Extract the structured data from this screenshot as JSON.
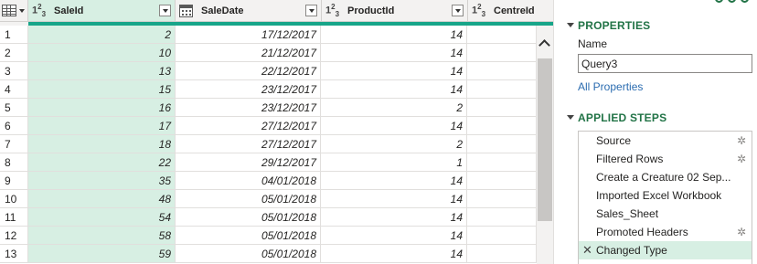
{
  "grid": {
    "columns": [
      {
        "name": "SaleId",
        "type": "1²3"
      },
      {
        "name": "SaleDate",
        "type": "date"
      },
      {
        "name": "ProductId",
        "type": "1²3"
      },
      {
        "name": "CentreId",
        "type": "1²3"
      }
    ],
    "rows": [
      {
        "n": "1",
        "sale_id": "2",
        "sale_date": "17/12/2017",
        "product_id": "14"
      },
      {
        "n": "2",
        "sale_id": "10",
        "sale_date": "21/12/2017",
        "product_id": "14"
      },
      {
        "n": "3",
        "sale_id": "13",
        "sale_date": "22/12/2017",
        "product_id": "14"
      },
      {
        "n": "4",
        "sale_id": "15",
        "sale_date": "23/12/2017",
        "product_id": "14"
      },
      {
        "n": "5",
        "sale_id": "16",
        "sale_date": "23/12/2017",
        "product_id": "2"
      },
      {
        "n": "6",
        "sale_id": "17",
        "sale_date": "27/12/2017",
        "product_id": "14"
      },
      {
        "n": "7",
        "sale_id": "18",
        "sale_date": "27/12/2017",
        "product_id": "2"
      },
      {
        "n": "8",
        "sale_id": "22",
        "sale_date": "29/12/2017",
        "product_id": "1"
      },
      {
        "n": "9",
        "sale_id": "35",
        "sale_date": "04/01/2018",
        "product_id": "14"
      },
      {
        "n": "10",
        "sale_id": "48",
        "sale_date": "05/01/2018",
        "product_id": "14"
      },
      {
        "n": "11",
        "sale_id": "54",
        "sale_date": "05/01/2018",
        "product_id": "14"
      },
      {
        "n": "12",
        "sale_id": "58",
        "sale_date": "05/01/2018",
        "product_id": "14"
      },
      {
        "n": "13",
        "sale_id": "59",
        "sale_date": "05/01/2018",
        "product_id": "14"
      }
    ],
    "selected_column_color": "#d7efe3",
    "quality_bar_color": "#17a589"
  },
  "properties": {
    "title": "PROPERTIES",
    "name_label": "Name",
    "name_value": "Query3",
    "all_properties_link": "All Properties"
  },
  "applied_steps": {
    "title": "APPLIED STEPS",
    "steps": [
      {
        "label": "Source",
        "has_gear": true
      },
      {
        "label": "Filtered Rows",
        "has_gear": true
      },
      {
        "label": "Create a Creature 02 Sep...",
        "has_gear": false
      },
      {
        "label": "Imported Excel Workbook",
        "has_gear": false
      },
      {
        "label": "Sales_Sheet",
        "has_gear": false
      },
      {
        "label": "Promoted Headers",
        "has_gear": true
      },
      {
        "label": "Changed Type",
        "has_gear": false,
        "selected": true
      }
    ]
  },
  "icons": {
    "table": "table-icon",
    "calendar": "calendar-icon",
    "gear": "gear-icon",
    "delete": "delete-step-icon",
    "scroll_up": "chevron-up-icon"
  }
}
